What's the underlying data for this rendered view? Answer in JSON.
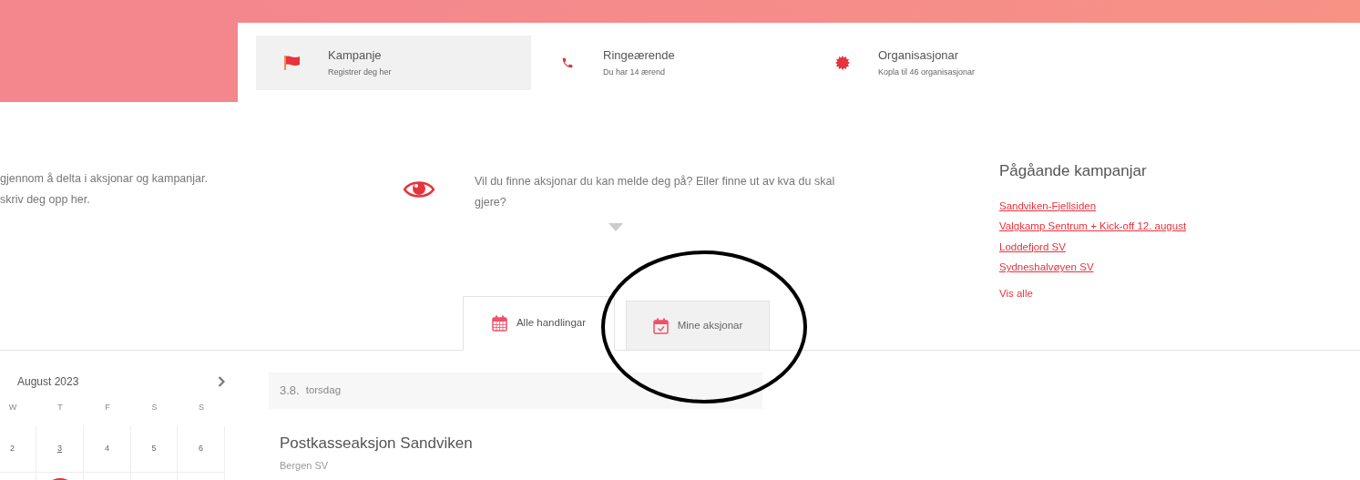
{
  "nav": [
    {
      "kind": "flag",
      "title": "Kampanje",
      "subtitle": "Registrer deg her",
      "selected": true
    },
    {
      "kind": "phone",
      "title": "Ringeærende",
      "subtitle": "Du har 14 ærend",
      "selected": false
    },
    {
      "kind": "badge",
      "title": "Organisasjonar",
      "subtitle": "Kopla til 46 organisasjonar",
      "selected": false
    }
  ],
  "intro": [
    "gjennom å delta i aksjonar og kampanjar.",
    "skriv deg opp her."
  ],
  "help": {
    "text": "Vil du finne aksjonar du kan melde deg på? Eller finne ut av kva du skal gjere?"
  },
  "campaigns": {
    "title": "Pågåande kampanjar",
    "items": [
      "Sandviken-Fjellsiden",
      "Valgkamp Sentrum + Kick-off 12. august",
      "Loddefjord SV",
      "Sydneshalvøyen SV"
    ],
    "more": "Vis alle"
  },
  "tabs": [
    {
      "kind": "grid",
      "label": "Alle handlingar",
      "selected": true
    },
    {
      "kind": "check",
      "label": "Mine aksjonar",
      "selected": false
    }
  ],
  "calendar": {
    "month": "August 2023",
    "weekdays": [
      "W",
      "T",
      "F",
      "S",
      "S"
    ],
    "weeks": [
      {
        "days": [
          {
            "label": "2",
            "selected": false
          },
          {
            "label": "3",
            "selected": false,
            "today": true
          },
          {
            "label": "4",
            "selected": false
          },
          {
            "label": "5",
            "selected": false
          },
          {
            "label": "6",
            "selected": false
          }
        ]
      },
      {
        "days": [
          {
            "selected": false
          },
          {
            "selected": true
          },
          {
            "selected": false
          },
          {
            "selected": false
          },
          {
            "selected": false
          }
        ]
      }
    ]
  },
  "events": {
    "date": "3.8.",
    "weekday": "torsdag",
    "items": [
      {
        "title": "Postkasseaksjon Sandviken",
        "org": "Bergen SV"
      }
    ]
  },
  "annotation": {
    "kind": "ellipse"
  }
}
